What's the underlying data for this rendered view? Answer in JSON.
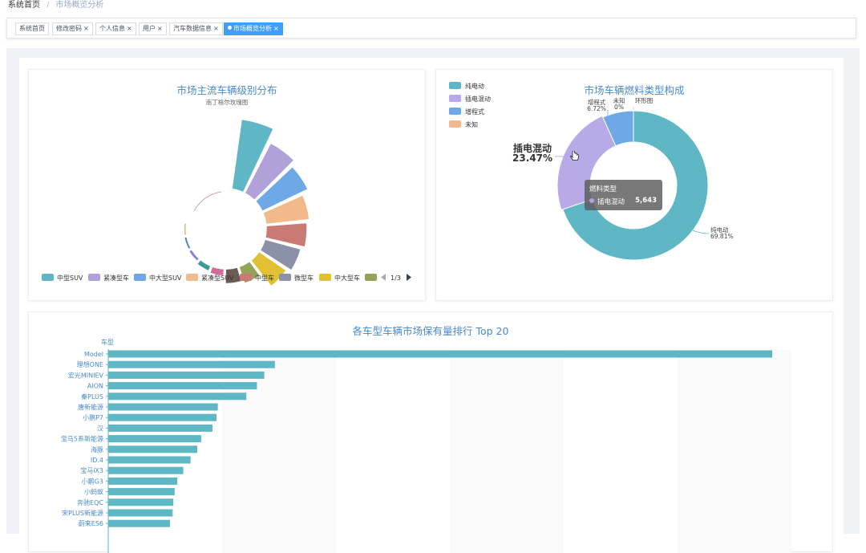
{
  "breadcrumb": {
    "home": "系统首页",
    "sep": "/",
    "current": "市场概览分析"
  },
  "tags": [
    {
      "label": "系统首页",
      "closable": false,
      "active": false
    },
    {
      "label": "修改密码",
      "closable": true,
      "active": false
    },
    {
      "label": "个人信息",
      "closable": true,
      "active": false
    },
    {
      "label": "用户",
      "closable": true,
      "active": false
    },
    {
      "label": "汽车数据信息",
      "closable": true,
      "active": false
    },
    {
      "label": "市场概览分析",
      "closable": true,
      "active": true
    }
  ],
  "close_glyph": "×",
  "colors": [
    "#5fb6c4",
    "#b0a1d8",
    "#6ea8e6",
    "#f2b98b",
    "#c97a73",
    "#8a91a8",
    "#e2c034",
    "#93a458",
    "#6b5b52",
    "#d36b9a",
    "#3d9a97",
    "#8f7fd4",
    "#4f86c6",
    "#e09a5a"
  ],
  "rose": {
    "chart_data": {
      "type": "pie",
      "title": "市场主流车辆级别分布",
      "subtitle": "南丁格尔玫瑰图",
      "categories": [
        "中型SUV",
        "紧凑型车",
        "中大型SUV",
        "紧凑型SUV",
        "中型车",
        "微型车",
        "中大型车"
      ],
      "values": [
        100,
        80,
        72,
        62,
        58,
        53,
        47,
        25,
        21,
        10,
        8,
        5,
        4,
        3
      ],
      "legend_page": "1/3"
    }
  },
  "fuel": {
    "chart_data": {
      "type": "pie",
      "title": "市场车辆燃料类型构成",
      "series_name": "环形图",
      "categories": [
        "纯电动",
        "插电混动",
        "增程式",
        "未知"
      ],
      "values": [
        69.81,
        23.47,
        6.72,
        0
      ],
      "labels": [
        "纯电动\n69.81%",
        "插电混动\n23.47%",
        "增程式\n6.72%",
        "未知\n0%"
      ]
    },
    "tooltip": {
      "title": "燃料类型",
      "name": "插电混动",
      "value": "5,643"
    },
    "emphasis_label": {
      "name": "插电混动",
      "percent": "23.47%"
    }
  },
  "ranking": {
    "chart_data": {
      "type": "bar",
      "title": "各车型车辆市场保有量排行 Top 20",
      "ylabel": "车型",
      "categories": [
        "Model",
        "理想ONE",
        "宏光MINIEV",
        "AION",
        "秦PLUS",
        "唐新能源",
        "小鹏P7",
        "汉",
        "宝马5系新能源",
        "海豚",
        "ID.4",
        "宝马iX3",
        "小鹏G3",
        "小蚂蚁",
        "奔驰EQC",
        "宋PLUS新能源",
        "蔚来ES6"
      ],
      "values": [
        100,
        25.1,
        23.5,
        22.4,
        20.8,
        16.5,
        16.3,
        15.7,
        14.0,
        13.4,
        12.4,
        11.3,
        10.4,
        10.0,
        9.8,
        9.7,
        9.3
      ],
      "xlim": [
        0,
        100
      ]
    }
  }
}
